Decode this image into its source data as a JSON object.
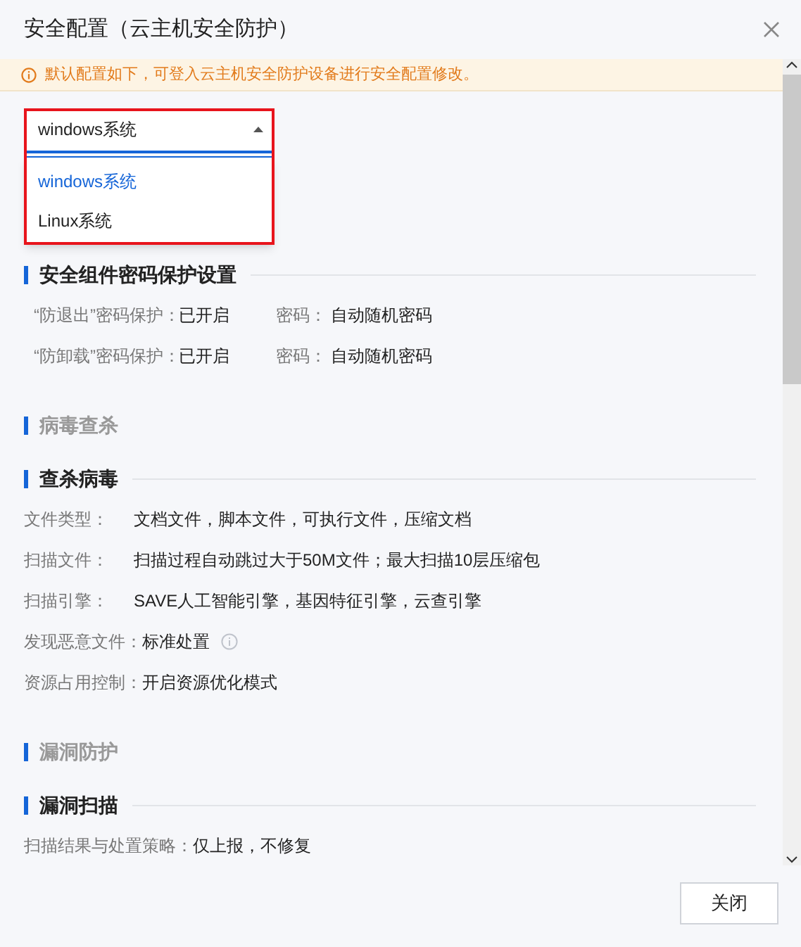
{
  "title": "安全配置（云主机安全防护）",
  "notice": "默认配置如下，可登入云主机安全防护设备进行安全配置修改。",
  "os_select": {
    "value": "windows系统",
    "open": true,
    "options": [
      {
        "label": "windows系统",
        "selected": true
      },
      {
        "label": "Linux系统",
        "selected": false
      }
    ]
  },
  "sections": [
    {
      "kind": "subsection",
      "title": "安全组件密码保护设置",
      "rows": [
        {
          "kind": "password",
          "label": "“防退出”密码保护：",
          "value": "已开启",
          "label_2": "密码：",
          "value_2": "自动随机密码"
        },
        {
          "kind": "password",
          "label": "“防卸载”密码保护：",
          "value": "已开启",
          "label_2": "密码：",
          "value_2": "自动随机密码"
        }
      ]
    },
    {
      "kind": "group",
      "title": "病毒查杀"
    },
    {
      "kind": "subsection",
      "title": "查杀病毒",
      "rows": [
        {
          "kind": "field",
          "label": "文件类型：",
          "value": "文档文件，脚本文件，可执行文件，压缩文档",
          "info": false
        },
        {
          "kind": "field",
          "label": "扫描文件：",
          "value": "扫描过程自动跳过大于50M文件；最大扫描10层压缩包",
          "info": false
        },
        {
          "kind": "field",
          "label": "扫描引擎：",
          "value": "SAVE人工智能引擎，基因特征引擎，云查引擎",
          "info": false
        },
        {
          "kind": "field",
          "label": "发现恶意文件：",
          "value": "标准处置",
          "info": true
        },
        {
          "kind": "field",
          "label": "资源占用控制：",
          "value": "开启资源优化模式",
          "info": false
        }
      ]
    },
    {
      "kind": "group",
      "title": "漏洞防护"
    },
    {
      "kind": "subsection",
      "title": "漏洞扫描",
      "rows": [
        {
          "kind": "field",
          "label": "扫描结果与处置策略：",
          "value": "仅上报，不修复",
          "info": false
        }
      ]
    }
  ],
  "close_button": "关闭"
}
